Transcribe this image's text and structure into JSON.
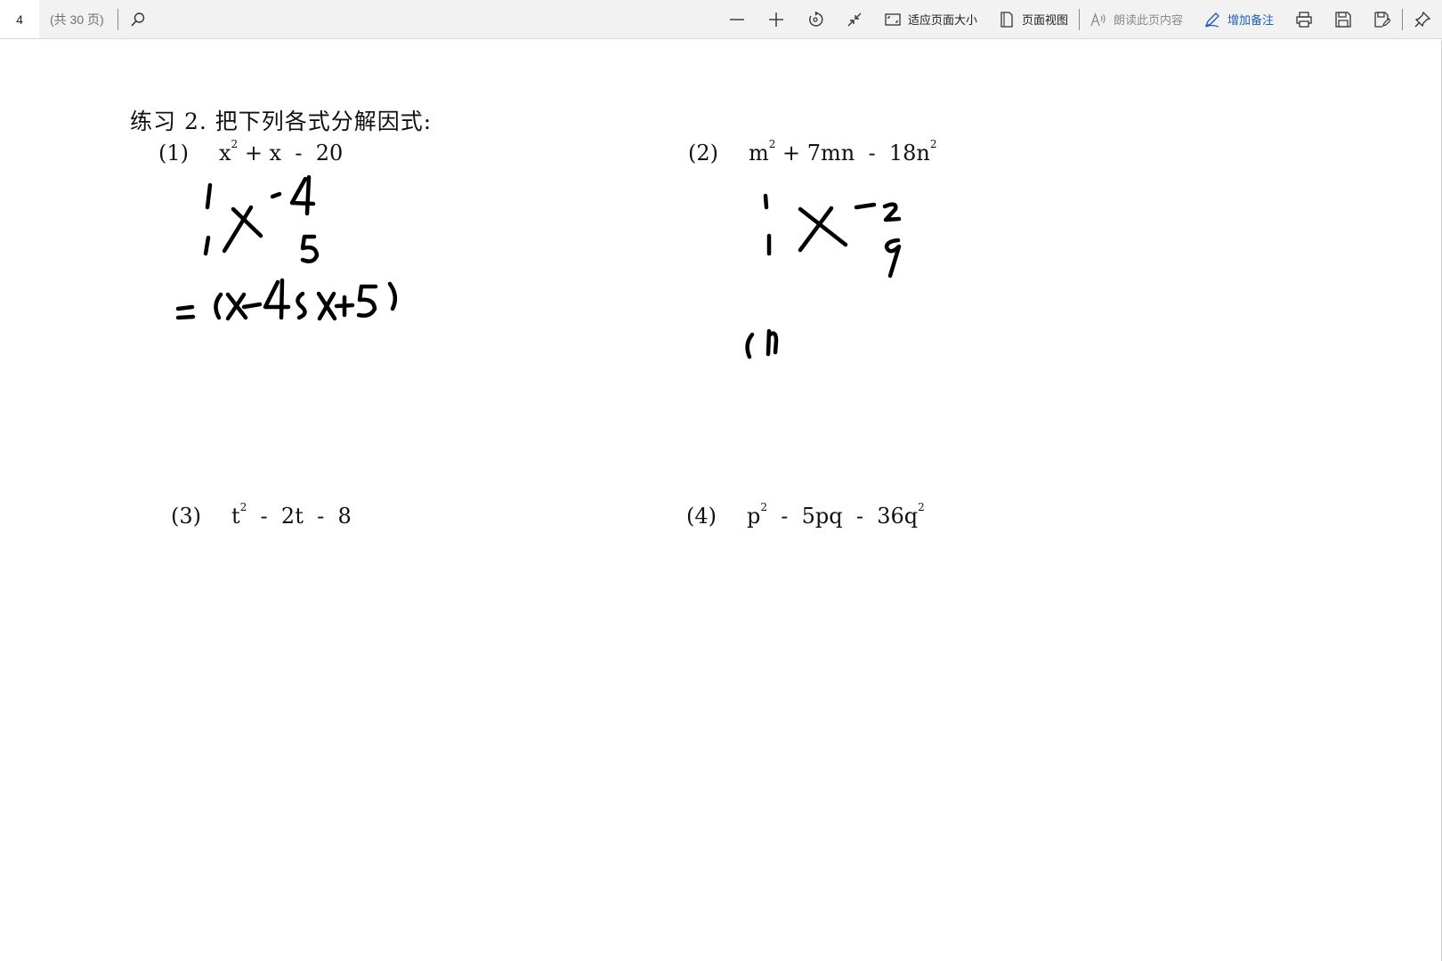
{
  "toolbar": {
    "page_number": "4",
    "page_total": "(共 30 页)",
    "fit_page_label": "适应页面大小",
    "page_view_label": "页面视图",
    "read_aloud_label": "朗读此页内容",
    "add_note_label": "增加备注",
    "accent_color": "#1d5fb4"
  },
  "icons": {
    "search": "search-icon",
    "zoom_out": "minus-icon",
    "zoom_in": "plus-icon",
    "rotate": "rotate-icon",
    "collapse": "collapse-icon",
    "fit_page": "fit-page-icon",
    "page_view": "page-view-icon",
    "read_aloud": "read-aloud-icon",
    "add_note": "pen-icon",
    "print": "print-icon",
    "save": "save-icon",
    "save_as": "save-as-icon",
    "pin": "pin-icon"
  },
  "document": {
    "title": "练习 2. 把下列各式分解因式:",
    "problems": [
      {
        "num": "(1)",
        "parts": [
          "x",
          "2",
          " + x  -  20"
        ]
      },
      {
        "num": "(2)",
        "parts": [
          "m",
          "2",
          " + 7mn  -  18n",
          "2"
        ]
      },
      {
        "num": "(3)",
        "parts": [
          "t",
          "2",
          "  -  2t  -  8"
        ]
      },
      {
        "num": "(4)",
        "parts": [
          "p",
          "2",
          "  -  5pq  -  36q",
          "2"
        ]
      }
    ]
  }
}
